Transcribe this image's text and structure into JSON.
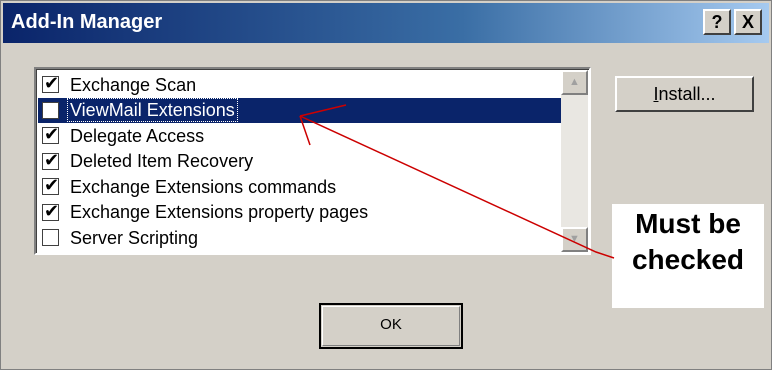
{
  "window": {
    "title": "Add-In Manager",
    "help_label": "?",
    "close_label": "X"
  },
  "addins": [
    {
      "label": "Exchange Scan",
      "checked": true,
      "selected": false
    },
    {
      "label": "ViewMail Extensions",
      "checked": false,
      "selected": true
    },
    {
      "label": "Delegate Access",
      "checked": true,
      "selected": false
    },
    {
      "label": "Deleted Item Recovery",
      "checked": true,
      "selected": false
    },
    {
      "label": "Exchange Extensions commands",
      "checked": true,
      "selected": false
    },
    {
      "label": "Exchange Extensions property pages",
      "checked": true,
      "selected": false
    },
    {
      "label": "Server Scripting",
      "checked": false,
      "selected": false
    }
  ],
  "buttons": {
    "install_accel": "I",
    "install_rest": "nstall...",
    "ok": "OK"
  },
  "annotation": {
    "text": "Must be\nchecked",
    "arrow_color": "#cc0000"
  }
}
